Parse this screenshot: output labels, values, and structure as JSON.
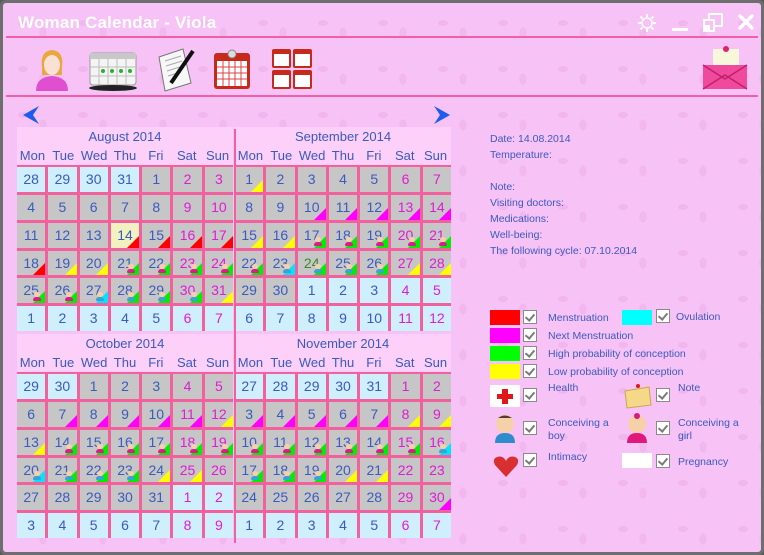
{
  "window": {
    "title": "Woman Calendar - Viola",
    "buttons": [
      "settings",
      "minimize",
      "restore",
      "close"
    ]
  },
  "toolbar": {
    "items": [
      {
        "name": "profile",
        "icon": "woman-profile-icon"
      },
      {
        "name": "cycle-table",
        "icon": "calendar-table-icon"
      },
      {
        "name": "notes",
        "icon": "notepad-pencil-icon"
      },
      {
        "name": "month-view",
        "icon": "calendar-month-icon"
      },
      {
        "name": "multi-month-view",
        "icon": "calendar-multi-icon"
      },
      {
        "name": "mail",
        "icon": "envelope-icon"
      }
    ]
  },
  "navigation": {
    "prev": "previous-icon",
    "next": "next-icon"
  },
  "weekdays": [
    "Mon",
    "Tue",
    "Wed",
    "Thu",
    "Fri",
    "Sat",
    "Sun"
  ],
  "months": [
    {
      "title": "August 2014",
      "cells": [
        {
          "d": "28",
          "o": 1
        },
        {
          "d": "29",
          "o": 1
        },
        {
          "d": "30",
          "o": 1
        },
        {
          "d": "31",
          "o": 1
        },
        {
          "d": "1"
        },
        {
          "d": "2",
          "we": 1
        },
        {
          "d": "3",
          "we": 1
        },
        {
          "d": "4"
        },
        {
          "d": "5"
        },
        {
          "d": "6"
        },
        {
          "d": "7"
        },
        {
          "d": "8"
        },
        {
          "d": "9",
          "we": 1
        },
        {
          "d": "10",
          "we": 1
        },
        {
          "d": "11"
        },
        {
          "d": "12"
        },
        {
          "d": "13"
        },
        {
          "d": "14",
          "today": 1,
          "m": "red"
        },
        {
          "d": "15",
          "m": "red"
        },
        {
          "d": "16",
          "we": 1,
          "m": "red"
        },
        {
          "d": "17",
          "we": 1,
          "m": "red"
        },
        {
          "d": "18",
          "m": "red"
        },
        {
          "d": "19",
          "m": "yel"
        },
        {
          "d": "20",
          "m": "yel"
        },
        {
          "d": "21",
          "m": "grn",
          "b": "girl"
        },
        {
          "d": "22",
          "m": "grn",
          "b": "girl"
        },
        {
          "d": "23",
          "we": 1,
          "m": "grn",
          "b": "girl"
        },
        {
          "d": "24",
          "we": 1,
          "m": "grn",
          "b": "girl"
        },
        {
          "d": "25",
          "m": "grn",
          "b": "girl"
        },
        {
          "d": "26",
          "m": "grn",
          "b": "girl"
        },
        {
          "d": "27",
          "m": "cyn",
          "b": "boy"
        },
        {
          "d": "28",
          "m": "grn",
          "b": "boy"
        },
        {
          "d": "29",
          "m": "grn",
          "b": "boy"
        },
        {
          "d": "30",
          "we": 1,
          "m": "grn",
          "b": "boy"
        },
        {
          "d": "31",
          "we": 1,
          "m": "yel"
        },
        {
          "d": "1",
          "o": 1
        },
        {
          "d": "2",
          "o": 1
        },
        {
          "d": "3",
          "o": 1
        },
        {
          "d": "4",
          "o": 1
        },
        {
          "d": "5",
          "o": 1
        },
        {
          "d": "6",
          "o": 1,
          "we": 1
        },
        {
          "d": "7",
          "o": 1,
          "we": 1
        }
      ]
    },
    {
      "title": "September 2014",
      "cells": [
        {
          "d": "1",
          "m": "yel"
        },
        {
          "d": "2"
        },
        {
          "d": "3"
        },
        {
          "d": "4"
        },
        {
          "d": "5"
        },
        {
          "d": "6",
          "we": 1
        },
        {
          "d": "7",
          "we": 1
        },
        {
          "d": "8"
        },
        {
          "d": "9"
        },
        {
          "d": "10",
          "m": "mag"
        },
        {
          "d": "11",
          "m": "mag"
        },
        {
          "d": "12",
          "m": "mag"
        },
        {
          "d": "13",
          "we": 1,
          "m": "mag"
        },
        {
          "d": "14",
          "we": 1,
          "m": "mag"
        },
        {
          "d": "15",
          "m": "yel"
        },
        {
          "d": "16",
          "m": "yel"
        },
        {
          "d": "17",
          "m": "grn",
          "b": "girl"
        },
        {
          "d": "18",
          "m": "grn",
          "b": "girl"
        },
        {
          "d": "19",
          "m": "grn",
          "b": "girl"
        },
        {
          "d": "20",
          "we": 1,
          "m": "grn",
          "b": "girl"
        },
        {
          "d": "21",
          "we": 1,
          "m": "grn",
          "b": "girl"
        },
        {
          "d": "22",
          "m": "grn",
          "b": "girl"
        },
        {
          "d": "23",
          "m": "cyn",
          "b": "boy"
        },
        {
          "d": "24",
          "g": 1,
          "m": "grn",
          "b": "boy"
        },
        {
          "d": "25",
          "m": "grn",
          "b": "boy"
        },
        {
          "d": "26",
          "m": "grn",
          "b": "boy"
        },
        {
          "d": "27",
          "we": 1,
          "m": "yel"
        },
        {
          "d": "28",
          "we": 1,
          "m": "yel"
        },
        {
          "d": "29"
        },
        {
          "d": "30"
        },
        {
          "d": "1",
          "o": 1
        },
        {
          "d": "2",
          "o": 1
        },
        {
          "d": "3",
          "o": 1
        },
        {
          "d": "4",
          "o": 1,
          "we": 1
        },
        {
          "d": "5",
          "o": 1,
          "we": 1
        },
        {
          "d": "6",
          "o": 1
        },
        {
          "d": "7",
          "o": 1
        },
        {
          "d": "8",
          "o": 1
        },
        {
          "d": "9",
          "o": 1
        },
        {
          "d": "10",
          "o": 1
        },
        {
          "d": "11",
          "o": 1,
          "we": 1
        },
        {
          "d": "12",
          "o": 1,
          "we": 1
        }
      ]
    },
    {
      "title": "October 2014",
      "cells": [
        {
          "d": "29",
          "o": 1
        },
        {
          "d": "30",
          "o": 1
        },
        {
          "d": "1"
        },
        {
          "d": "2"
        },
        {
          "d": "3"
        },
        {
          "d": "4",
          "we": 1
        },
        {
          "d": "5",
          "we": 1
        },
        {
          "d": "6"
        },
        {
          "d": "7",
          "m": "mag"
        },
        {
          "d": "8",
          "m": "mag"
        },
        {
          "d": "9",
          "m": "mag"
        },
        {
          "d": "10",
          "m": "mag"
        },
        {
          "d": "11",
          "we": 1,
          "m": "mag"
        },
        {
          "d": "12",
          "we": 1,
          "m": "yel"
        },
        {
          "d": "13",
          "m": "yel"
        },
        {
          "d": "14",
          "m": "grn",
          "b": "girl"
        },
        {
          "d": "15",
          "m": "grn",
          "b": "girl"
        },
        {
          "d": "16",
          "m": "grn",
          "b": "girl"
        },
        {
          "d": "17",
          "m": "grn",
          "b": "girl"
        },
        {
          "d": "18",
          "we": 1,
          "m": "grn",
          "b": "girl"
        },
        {
          "d": "19",
          "we": 1,
          "m": "grn",
          "b": "girl"
        },
        {
          "d": "20",
          "m": "cyn",
          "b": "boy"
        },
        {
          "d": "21",
          "m": "grn",
          "b": "boy"
        },
        {
          "d": "22",
          "m": "grn",
          "b": "boy"
        },
        {
          "d": "23",
          "m": "grn",
          "b": "boy"
        },
        {
          "d": "24",
          "m": "yel"
        },
        {
          "d": "25",
          "we": 1,
          "m": "yel"
        },
        {
          "d": "26",
          "we": 1
        },
        {
          "d": "27"
        },
        {
          "d": "28"
        },
        {
          "d": "29"
        },
        {
          "d": "30"
        },
        {
          "d": "31"
        },
        {
          "d": "1",
          "o": 1,
          "we": 1
        },
        {
          "d": "2",
          "o": 1,
          "we": 1
        },
        {
          "d": "3",
          "o": 1
        },
        {
          "d": "4",
          "o": 1
        },
        {
          "d": "5",
          "o": 1
        },
        {
          "d": "6",
          "o": 1
        },
        {
          "d": "7",
          "o": 1
        },
        {
          "d": "8",
          "o": 1,
          "we": 1
        },
        {
          "d": "9",
          "o": 1,
          "we": 1
        }
      ]
    },
    {
      "title": "November 2014",
      "cells": [
        {
          "d": "27",
          "o": 1
        },
        {
          "d": "28",
          "o": 1
        },
        {
          "d": "29",
          "o": 1
        },
        {
          "d": "30",
          "o": 1
        },
        {
          "d": "31",
          "o": 1
        },
        {
          "d": "1",
          "we": 1
        },
        {
          "d": "2",
          "we": 1
        },
        {
          "d": "3",
          "m": "mag"
        },
        {
          "d": "4",
          "m": "mag"
        },
        {
          "d": "5",
          "m": "mag"
        },
        {
          "d": "6",
          "m": "mag"
        },
        {
          "d": "7",
          "m": "mag"
        },
        {
          "d": "8",
          "we": 1,
          "m": "yel"
        },
        {
          "d": "9",
          "we": 1,
          "m": "yel"
        },
        {
          "d": "10",
          "m": "grn",
          "b": "girl"
        },
        {
          "d": "11",
          "m": "grn",
          "b": "girl"
        },
        {
          "d": "12",
          "m": "grn",
          "b": "girl"
        },
        {
          "d": "13",
          "m": "grn",
          "b": "girl"
        },
        {
          "d": "14",
          "m": "grn",
          "b": "girl"
        },
        {
          "d": "15",
          "we": 1,
          "m": "grn",
          "b": "girl"
        },
        {
          "d": "16",
          "we": 1,
          "m": "cyn",
          "b": "boy"
        },
        {
          "d": "17",
          "m": "grn",
          "b": "boy"
        },
        {
          "d": "18",
          "m": "grn",
          "b": "boy"
        },
        {
          "d": "19",
          "m": "grn",
          "b": "boy"
        },
        {
          "d": "20",
          "m": "yel"
        },
        {
          "d": "21",
          "m": "yel"
        },
        {
          "d": "22",
          "we": 1
        },
        {
          "d": "23",
          "we": 1
        },
        {
          "d": "24"
        },
        {
          "d": "25"
        },
        {
          "d": "26"
        },
        {
          "d": "27"
        },
        {
          "d": "28"
        },
        {
          "d": "29",
          "we": 1
        },
        {
          "d": "30",
          "we": 1,
          "m": "mag"
        },
        {
          "d": "1",
          "o": 1
        },
        {
          "d": "2",
          "o": 1
        },
        {
          "d": "3",
          "o": 1
        },
        {
          "d": "4",
          "o": 1
        },
        {
          "d": "5",
          "o": 1
        },
        {
          "d": "6",
          "o": 1,
          "we": 1
        },
        {
          "d": "7",
          "o": 1,
          "we": 1
        }
      ]
    }
  ],
  "info": {
    "date": "Date: 14.08.2014",
    "temperature": "Temperature:",
    "note": "Note:",
    "visiting_doctors": "Visiting doctors:",
    "medications": "Medications:",
    "well_being": "Well-being:",
    "following_cycle": "The following cycle: 07.10.2014"
  },
  "legend": {
    "menstruation": {
      "label": "Menstruation",
      "color": "#ff0000",
      "checked": true
    },
    "ovulation": {
      "label": "Ovulation",
      "color": "#00ffff",
      "checked": true
    },
    "next_menstruation": {
      "label": "Next Menstruation",
      "color": "#ff00ff",
      "checked": true
    },
    "high_probability": {
      "label": "High probability of conception",
      "color": "#00ff00",
      "checked": true
    },
    "low_probability": {
      "label": "Low probability of conception",
      "color": "#ffff00",
      "checked": true
    },
    "health": {
      "label": "Health",
      "icon": "red-cross-icon",
      "checked": true
    },
    "note": {
      "label": "Note",
      "icon": "note-icon",
      "checked": true
    },
    "conceiving_boy": {
      "label": "Conceiving a boy",
      "icon": "baby-boy-icon",
      "checked": true
    },
    "conceiving_girl": {
      "label": "Conceiving a girl",
      "icon": "baby-girl-icon",
      "checked": true
    },
    "intimacy": {
      "label": "Intimacy",
      "icon": "heart-icon",
      "checked": true
    },
    "pregnancy": {
      "label": "Pregnancy",
      "color": "#ffffff",
      "checked": true
    }
  }
}
